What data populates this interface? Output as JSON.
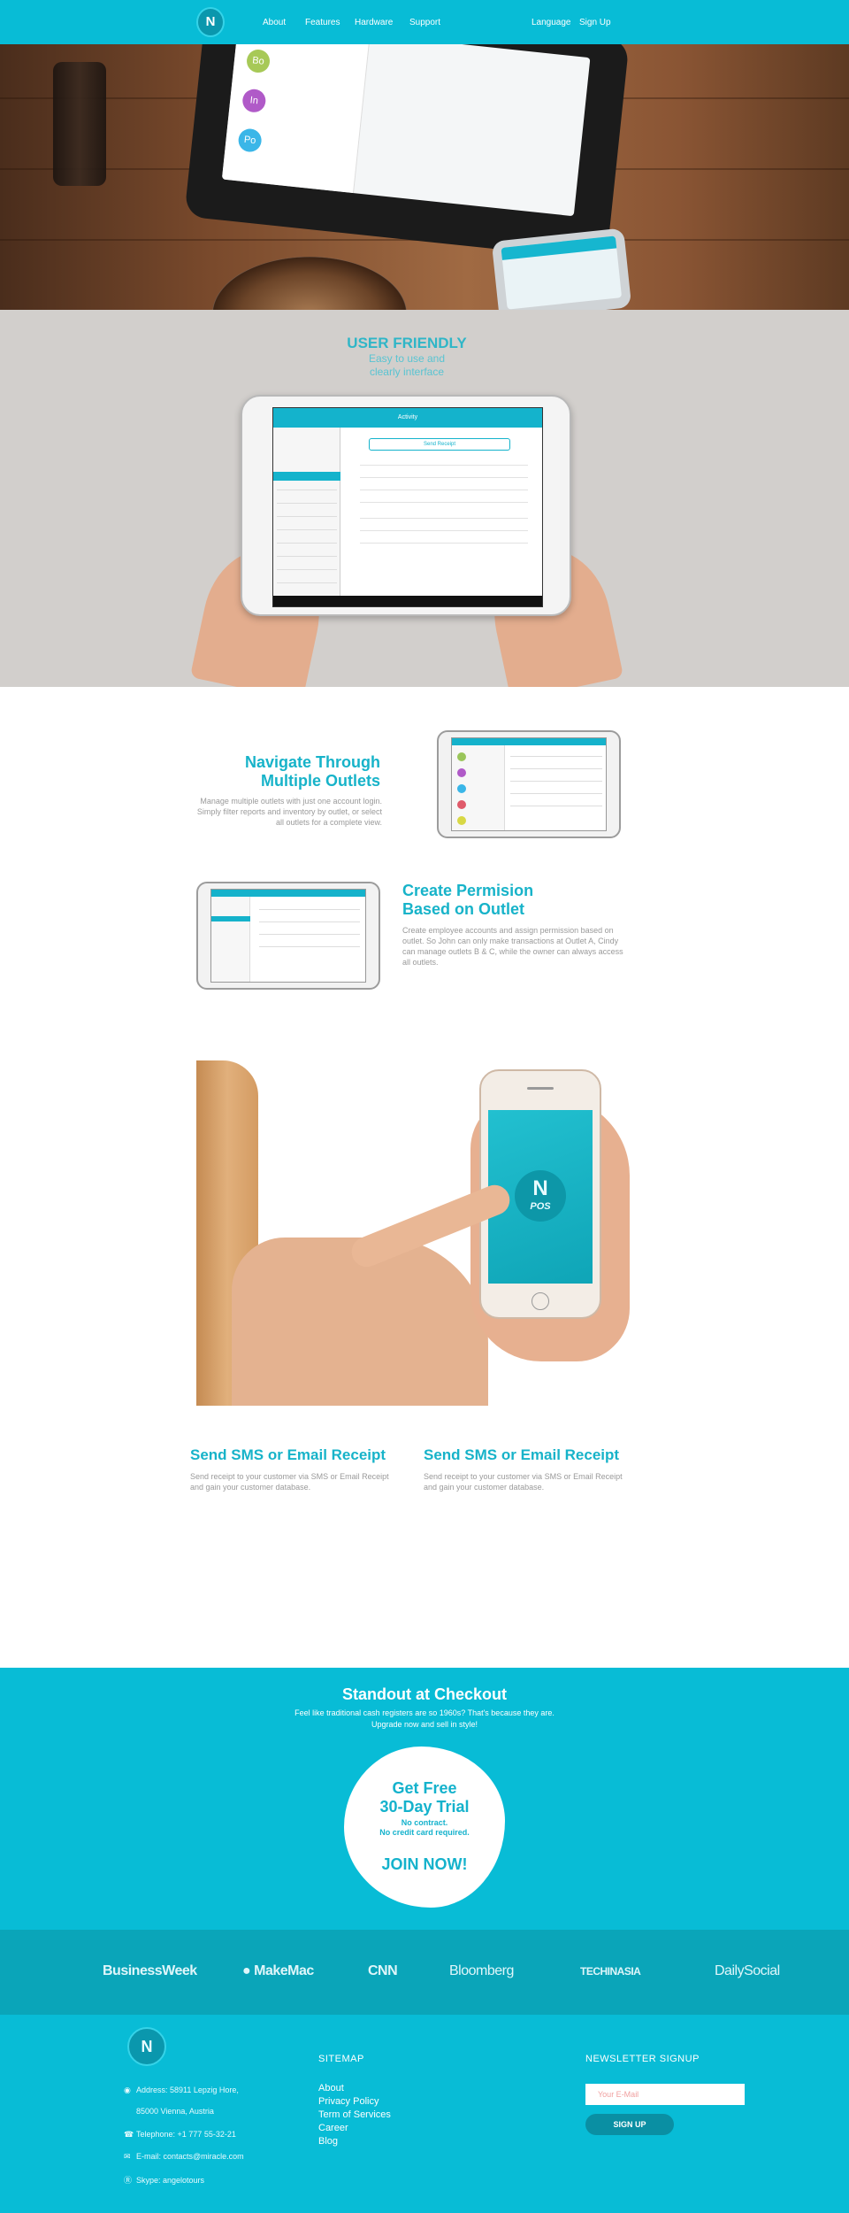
{
  "nav": {
    "logo": "N",
    "links": [
      "About",
      "Features",
      "Hardware",
      "Support"
    ],
    "language": "Language",
    "signup": "Sign Up"
  },
  "hero": {
    "avatars": [
      "Bo",
      "In",
      "Po"
    ],
    "avatar_colors": [
      "#a7c957",
      "#b05ac8",
      "#3ab6e8"
    ]
  },
  "user_friendly": {
    "title": "USER FRIENDLY",
    "subtitle_1": "Easy to use and",
    "subtitle_2": "clearly interface",
    "screen_title": "Activity",
    "screen_button": "Send Receipt"
  },
  "features": [
    {
      "title_1": "Navigate Through",
      "title_2": "Multiple Outlets",
      "text": "Manage multiple outlets with just one account login. Simply filter reports and inventory by outlet, or select all outlets for a complete view."
    },
    {
      "title_1": "Create Permision",
      "title_2": "Based on Outlet",
      "text": "Create employee accounts and assign permission based on outlet. So John can only make transactions at Outlet A, Cindy can manage outlets B & C, while the owner can always access all outlets."
    }
  ],
  "phone_logo": {
    "n": "N",
    "pos": "POS"
  },
  "receipts": [
    {
      "title": "Send SMS or Email Receipt",
      "text": "Send receipt to your customer via SMS or Email Receipt and gain your customer database."
    },
    {
      "title": "Send SMS or Email Receipt",
      "text": "Send receipt to your customer via SMS or Email Receipt and gain your customer database."
    }
  ],
  "checkout": {
    "title": "Standout at Checkout",
    "text_1": "Feel like traditional cash registers are so 1960s? That's because they are.",
    "text_2": "Upgrade now and sell in style!",
    "badge_title_1": "Get Free",
    "badge_title_2": "30-Day Trial",
    "badge_note_1": "No contract.",
    "badge_note_2": "No credit card required.",
    "cta": "JOIN NOW!"
  },
  "press": [
    "BusinessWeek",
    "MakeMac",
    "CNN",
    "Bloomberg",
    "TECHINASIA",
    "DailySocial"
  ],
  "footer": {
    "logo": "N",
    "address_1": "Address: 58911 Lepzig Hore,",
    "address_2": "85000 Vienna, Austria",
    "telephone": "Telephone: +1 777 55-32-21",
    "email": "E-mail: contacts@miracle.com",
    "skype": "Skype: angelotours",
    "sitemap_title": "SITEMAP",
    "sitemap": [
      "About",
      "Privacy Policy",
      "Term of Services",
      "Career",
      "Blog"
    ],
    "newsletter_title": "NEWSLETTER SIGNUP",
    "email_placeholder": "Your E-Mail",
    "signup_button": "SIGN UP"
  },
  "colors": {
    "brand": "#08bcd6",
    "brand_dark": "#0aa5b9",
    "heading": "#17b3c9"
  }
}
